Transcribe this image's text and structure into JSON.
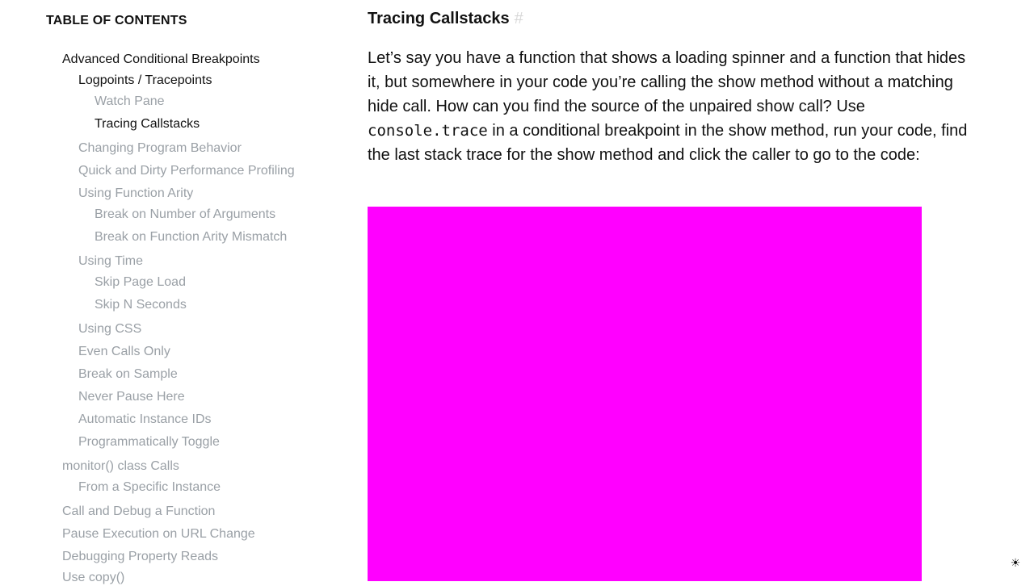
{
  "toc": {
    "title": "TABLE OF CONTENTS",
    "items": [
      {
        "label": "Advanced Conditional Breakpoints",
        "state": "ancestor"
      },
      {
        "label": "Logpoints / Tracepoints",
        "state": "ancestor"
      },
      {
        "label": "Watch Pane",
        "state": "muted"
      },
      {
        "label": "Tracing Callstacks",
        "state": "current"
      },
      {
        "label": "Changing Program Behavior",
        "state": "muted"
      },
      {
        "label": "Quick and Dirty Performance Profiling",
        "state": "muted"
      },
      {
        "label": "Using Function Arity",
        "state": "muted"
      },
      {
        "label": "Break on Number of Arguments",
        "state": "muted"
      },
      {
        "label": "Break on Function Arity Mismatch",
        "state": "muted"
      },
      {
        "label": "Using Time",
        "state": "muted"
      },
      {
        "label": "Skip Page Load",
        "state": "muted"
      },
      {
        "label": "Skip N Seconds",
        "state": "muted"
      },
      {
        "label": "Using CSS",
        "state": "muted"
      },
      {
        "label": "Even Calls Only",
        "state": "muted"
      },
      {
        "label": "Break on Sample",
        "state": "muted"
      },
      {
        "label": "Never Pause Here",
        "state": "muted"
      },
      {
        "label": "Automatic Instance IDs",
        "state": "muted"
      },
      {
        "label": "Programmatically Toggle",
        "state": "muted"
      },
      {
        "label": "monitor() class Calls",
        "state": "muted"
      },
      {
        "label": "From a Specific Instance",
        "state": "muted"
      },
      {
        "label": "Call and Debug a Function",
        "state": "muted"
      },
      {
        "label": "Pause Execution on URL Change",
        "state": "muted"
      },
      {
        "label": "Debugging Property Reads",
        "state": "muted"
      },
      {
        "label": "Use copy()",
        "state": "muted"
      }
    ]
  },
  "article": {
    "heading": "Tracing Callstacks",
    "anchor": "#",
    "para_before_code": "Let’s say you have a function that shows a loading spinner and a function that hides it, but somewhere in your code you’re calling the show method without a matching hide call. How can you find the source of the unpaired show call? Use ",
    "code": "console.trace",
    "para_after_code": " in a conditional breakpoint in the show method, run your code, find the last stack trace for the show method and click the caller to go to the code:",
    "media_color": "#ff00ff"
  },
  "theme_toggle": {
    "icon": "sun-icon",
    "glyph": "☀"
  },
  "colors": {
    "text": "#111111",
    "muted": "#9aa0a6",
    "anchor": "#d8d8d8"
  }
}
